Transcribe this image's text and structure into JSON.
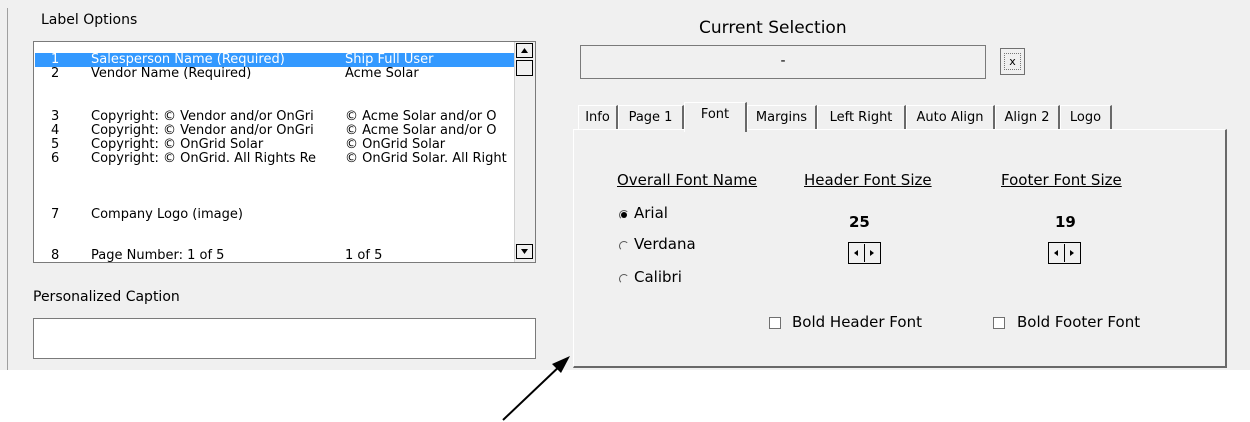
{
  "label_options": {
    "title": "Label Options",
    "rows": [
      {
        "num": "1",
        "label": "Salesperson Name  (Required)",
        "value": "Ship Full User",
        "selected": true
      },
      {
        "num": "2",
        "label": "Vendor Name  (Required)",
        "value": "Acme Solar",
        "selected": false
      },
      {
        "num": "3",
        "label": "Copyright:  © Vendor and/or OnGri",
        "value": "© Acme Solar and/or O",
        "selected": false
      },
      {
        "num": "4",
        "label": "Copyright:  © Vendor and/or OnGri",
        "value": "© Acme Solar and/or O",
        "selected": false
      },
      {
        "num": "5",
        "label": "Copyright:  © OnGrid Solar",
        "value": "© OnGrid Solar",
        "selected": false
      },
      {
        "num": "6",
        "label": "Copyright:  © OnGrid. All Rights Re",
        "value": "© OnGrid Solar. All Right",
        "selected": false
      },
      {
        "num": "7",
        "label": "Company Logo (image)",
        "value": "",
        "selected": false
      },
      {
        "num": "8",
        "label": "Page Number:  1 of 5",
        "value": "1 of 5",
        "selected": false
      }
    ],
    "scroll_up_icon": "triangle-up",
    "scroll_down_icon": "triangle-down"
  },
  "personalized_caption": {
    "title": "Personalized Caption",
    "value": ""
  },
  "current_selection": {
    "title": "Current Selection",
    "value": "-",
    "clear_label": "x"
  },
  "tabs": [
    {
      "label": "Info",
      "active": false
    },
    {
      "label": "Page 1",
      "active": false
    },
    {
      "label": "Font",
      "active": true
    },
    {
      "label": "Margins",
      "active": false
    },
    {
      "label": "Left Right",
      "active": false
    },
    {
      "label": "Auto Align",
      "active": false
    },
    {
      "label": "Align 2",
      "active": false
    },
    {
      "label": "Logo",
      "active": false
    }
  ],
  "font_tab": {
    "overall_font_name_label": "Overall Font Name",
    "fonts": [
      {
        "label": "Arial",
        "selected": true
      },
      {
        "label": "Verdana",
        "selected": false
      },
      {
        "label": "Calibri",
        "selected": false
      }
    ],
    "header_font_size_label": "Header Font Size",
    "header_font_size": "25",
    "footer_font_size_label": "Footer Font Size",
    "footer_font_size": "19",
    "bold_header_label": "Bold Header Font",
    "bold_header_checked": false,
    "bold_footer_label": "Bold Footer Font",
    "bold_footer_checked": false
  },
  "colors": {
    "panel": "#f0f0f0",
    "selection_highlight": "#3399ff"
  }
}
